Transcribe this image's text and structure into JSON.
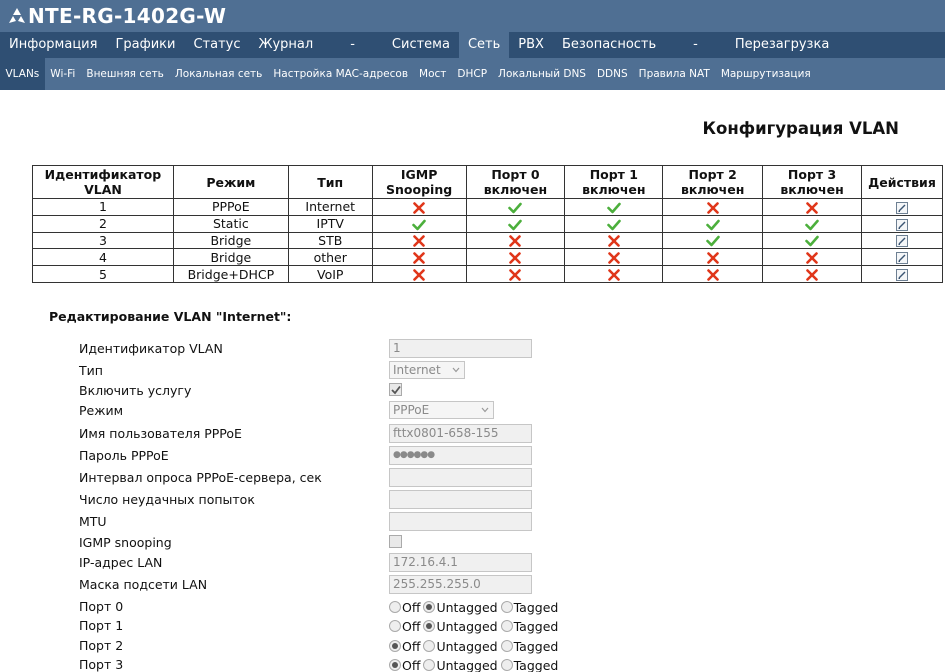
{
  "app": {
    "title": "NTE-RG-1402G-W",
    "logo_icon": "eltex-arrows-icon"
  },
  "main_nav": [
    {
      "label": "Информация",
      "active": false
    },
    {
      "label": "Графики",
      "active": false
    },
    {
      "label": "Статус",
      "active": false
    },
    {
      "label": "Журнал",
      "active": false
    },
    {
      "label": "-",
      "active": false
    },
    {
      "label": "Система",
      "active": false
    },
    {
      "label": "Сеть",
      "active": true
    },
    {
      "label": "PBX",
      "active": false
    },
    {
      "label": "Безопасность",
      "active": false
    },
    {
      "label": "-",
      "active": false
    },
    {
      "label": "Перезагрузка",
      "active": false
    }
  ],
  "sub_nav": [
    {
      "label": "VLANs",
      "active": true
    },
    {
      "label": "Wi-Fi",
      "active": false
    },
    {
      "label": "Внешняя сеть",
      "active": false
    },
    {
      "label": "Локальная сеть",
      "active": false
    },
    {
      "label": "Настройка MAC-адресов",
      "active": false
    },
    {
      "label": "Мост",
      "active": false
    },
    {
      "label": "DHCP",
      "active": false
    },
    {
      "label": "Локальный DNS",
      "active": false
    },
    {
      "label": "DDNS",
      "active": false
    },
    {
      "label": "Правила NAT",
      "active": false
    },
    {
      "label": "Маршрутизация",
      "active": false
    }
  ],
  "page_title": "Конфигурация VLAN",
  "table": {
    "headers": [
      "Идентификатор VLAN",
      "Режим",
      "Тип",
      "IGMP Snooping",
      "Порт 0 включен",
      "Порт 1 включен",
      "Порт 2 включен",
      "Порт 3 включен",
      "Действия"
    ],
    "rows": [
      {
        "id": "1",
        "mode": "PPPoE",
        "type": "Internet",
        "igmp": false,
        "p0": true,
        "p1": true,
        "p2": false,
        "p3": false
      },
      {
        "id": "2",
        "mode": "Static",
        "type": "IPTV",
        "igmp": true,
        "p0": true,
        "p1": true,
        "p2": true,
        "p3": true
      },
      {
        "id": "3",
        "mode": "Bridge",
        "type": "STB",
        "igmp": false,
        "p0": false,
        "p1": false,
        "p2": true,
        "p3": true
      },
      {
        "id": "4",
        "mode": "Bridge",
        "type": "other",
        "igmp": false,
        "p0": false,
        "p1": false,
        "p2": false,
        "p3": false
      },
      {
        "id": "5",
        "mode": "Bridge+DHCP",
        "type": "VoIP",
        "igmp": false,
        "p0": false,
        "p1": false,
        "p2": false,
        "p3": false
      }
    ],
    "action_icon": "edit-icon",
    "colors": {
      "check": "#4caf3c",
      "cross": "#e0361a"
    }
  },
  "edit": {
    "title": "Редактирование VLAN \"Internet\":",
    "fields": {
      "vlan_id": {
        "label": "Идентификатор VLAN",
        "value": "1"
      },
      "type": {
        "label": "Тип",
        "value": "Internet"
      },
      "enable": {
        "label": "Включить услугу",
        "checked": true
      },
      "mode": {
        "label": "Режим",
        "value": "PPPoE"
      },
      "pppoe_user": {
        "label": "Имя пользователя PPPoE",
        "value": "fttx0801-658-155"
      },
      "pppoe_pass": {
        "label": "Пароль PPPoE",
        "value": "●●●●●●"
      },
      "pppoe_interval": {
        "label": "Интервал опроса PPPoE-сервера, сек",
        "value": ""
      },
      "fail_count": {
        "label": "Число неудачных попыток",
        "value": ""
      },
      "mtu": {
        "label": "MTU",
        "value": ""
      },
      "igmp": {
        "label": "IGMP snooping",
        "checked": false
      },
      "lan_ip": {
        "label": "IP-адрес LAN",
        "value": "172.16.4.1"
      },
      "lan_mask": {
        "label": "Маска подсети LAN",
        "value": "255.255.255.0"
      }
    },
    "radio_labels": {
      "off": "Off",
      "untagged": "Untagged",
      "tagged": "Tagged"
    },
    "ports": [
      {
        "label": "Порт 0",
        "value": "untagged"
      },
      {
        "label": "Порт 1",
        "value": "untagged"
      },
      {
        "label": "Порт 2",
        "value": "off"
      },
      {
        "label": "Порт 3",
        "value": "off"
      }
    ]
  }
}
